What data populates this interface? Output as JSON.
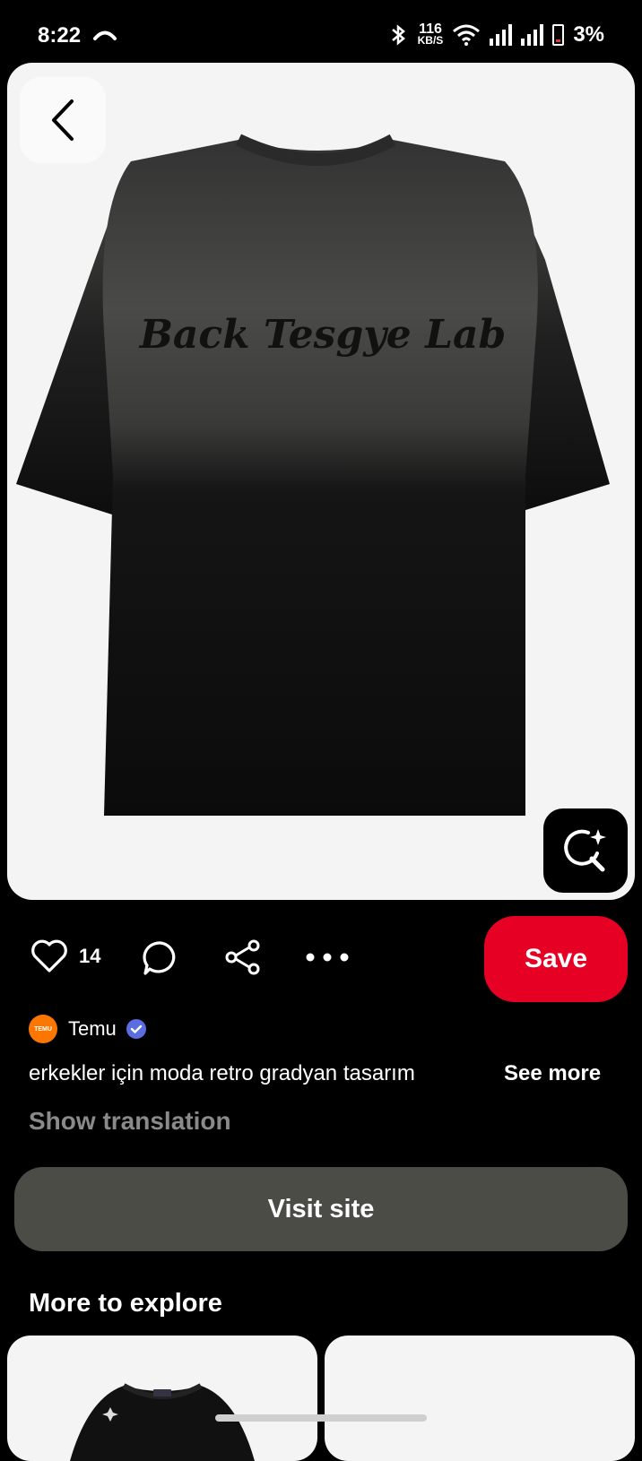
{
  "status_bar": {
    "time": "8:22",
    "net_speed_value": "116",
    "net_speed_unit": "KB/S",
    "battery": "3%"
  },
  "pin": {
    "image_print_text": "Back Tesgye Lab",
    "like_count": "14",
    "save_label": "Save"
  },
  "creator": {
    "avatar_text": "TEMU",
    "name": "Temu",
    "verified": true,
    "brand_color": "#fb7701"
  },
  "description": {
    "text": "erkekler için moda retro gradyan tasarım",
    "see_more": "See more",
    "show_translation": "Show translation"
  },
  "visit_site_label": "Visit site",
  "more_to_explore": {
    "title": "More to explore"
  },
  "colors": {
    "save_red": "#e60023",
    "visit_button": "#4b4c46",
    "verified_blue": "#5b6ee1"
  },
  "icons": [
    "back-chevron-icon",
    "visual-search-icon",
    "heart-icon",
    "comment-icon",
    "share-icon",
    "more-dots-icon",
    "verified-icon"
  ]
}
